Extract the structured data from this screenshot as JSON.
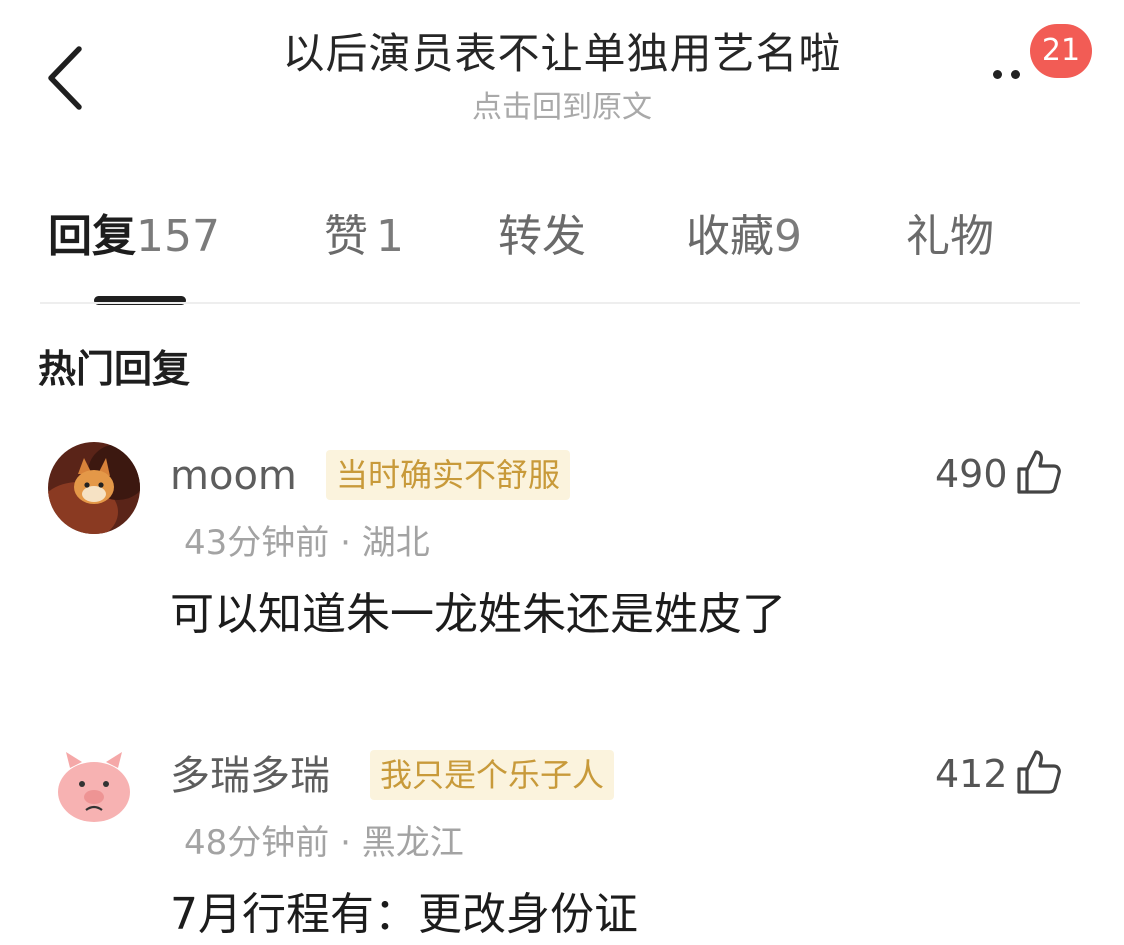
{
  "header": {
    "title": "以后演员表不让单独用艺名啦",
    "subtitle": "点击回到原文",
    "badge_count": "21",
    "back_icon": "chevron-left-icon",
    "more_icon": "more-dots-icon"
  },
  "tabs": [
    {
      "label": "回复",
      "count": "157",
      "active": true
    },
    {
      "label": "赞",
      "count": "1",
      "active": false
    },
    {
      "label": "转发",
      "count": "",
      "active": false
    },
    {
      "label": "收藏",
      "count": "9",
      "active": false
    },
    {
      "label": "礼物",
      "count": "",
      "active": false
    }
  ],
  "section": {
    "title": "热门回复"
  },
  "comments": [
    {
      "username": "moom",
      "tag": "当时确实不舒服",
      "time": "43分钟前",
      "location": "湖北",
      "text": "可以知道朱一龙姓朱还是姓皮了",
      "likes": "490",
      "avatar_icon": "cat-avatar-icon"
    },
    {
      "username": "多瑞多瑞",
      "tag": "我只是个乐子人",
      "time": "48分钟前",
      "location": "黑龙江",
      "text": "7月行程有：更改身份证",
      "likes": "412",
      "avatar_icon": "pig-avatar-icon"
    }
  ],
  "colors": {
    "badge": "#f25c55",
    "tag_bg": "#fbf3dd",
    "tag_text": "#c89a3a",
    "meta_text": "#a3a3a3"
  }
}
